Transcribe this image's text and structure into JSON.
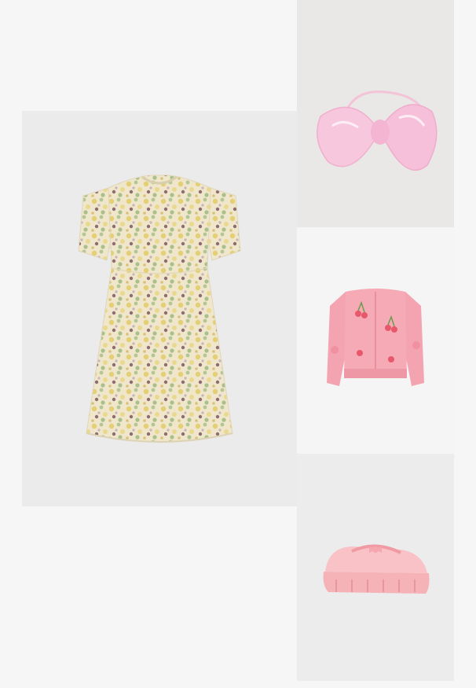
{
  "board": {
    "items": [
      {
        "id": "dress",
        "product": "floral-sequin-mini-dress"
      },
      {
        "id": "bow",
        "product": "pink-satin-bow-headband"
      },
      {
        "id": "cardigan",
        "product": "pink-knit-cardigan-with-cherries"
      },
      {
        "id": "shoes",
        "product": "pink-chunky-platform-mary-janes"
      }
    ]
  },
  "colors": {
    "background": "#f6f6f6",
    "dress_base": "#efe7cf",
    "dress_yellow": "#e6d27a",
    "dress_green": "#a9bf8c",
    "dress_mauve": "#8e6f73",
    "bow_pink": "#f6c6de",
    "cardigan_pink": "#f4a7b2",
    "shoe_pink": "#f5b9be"
  }
}
